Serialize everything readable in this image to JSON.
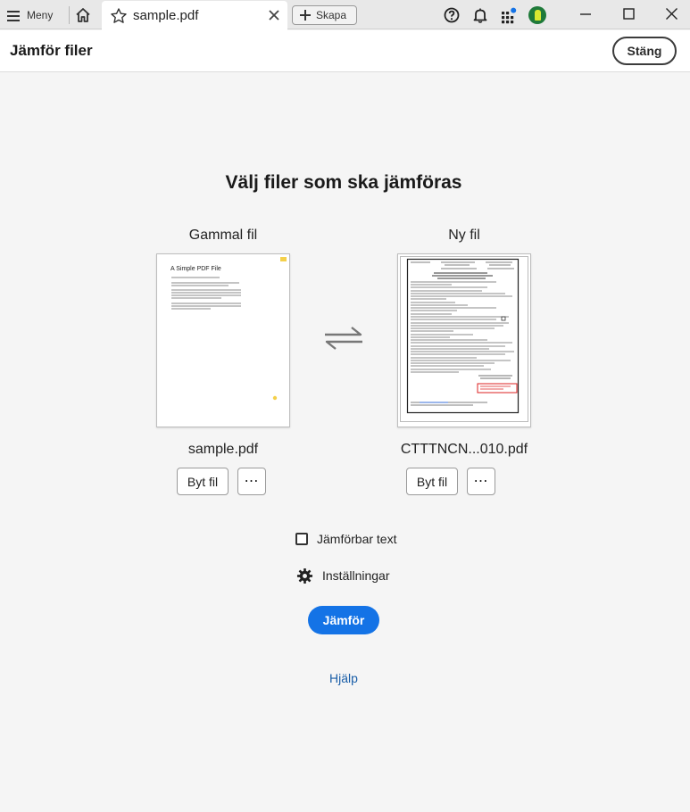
{
  "titlebar": {
    "menu_label": "Meny",
    "tab_title": "sample.pdf",
    "new_tab_label": "Skapa"
  },
  "header": {
    "title": "Jämför filer",
    "close_label": "Stäng"
  },
  "main": {
    "heading": "Välj filer som ska jämföras",
    "old_file": {
      "label": "Gammal fil",
      "file_name": "sample.pdf",
      "thumb_title": "A Simple PDF File",
      "replace_label": "Byt fil",
      "more_label": "⋯"
    },
    "new_file": {
      "label": "Ny fil",
      "file_name": "CTTTNCN...010.pdf",
      "replace_label": "Byt fil",
      "more_label": "⋯"
    },
    "comparable_text_label": "Jämförbar text",
    "settings_label": "Inställningar",
    "compare_label": "Jämför",
    "help_label": "Hjälp"
  },
  "colors": {
    "accent": "#1473e6",
    "link": "#1a5ea8",
    "notification_dot": "#1473e6"
  },
  "icons": [
    "menu-icon",
    "home-icon",
    "star-icon",
    "close-icon",
    "plus-icon",
    "help-icon",
    "bell-icon",
    "apps-icon",
    "avatar",
    "minimize-icon",
    "maximize-icon",
    "swap-icon",
    "gear-icon"
  ]
}
